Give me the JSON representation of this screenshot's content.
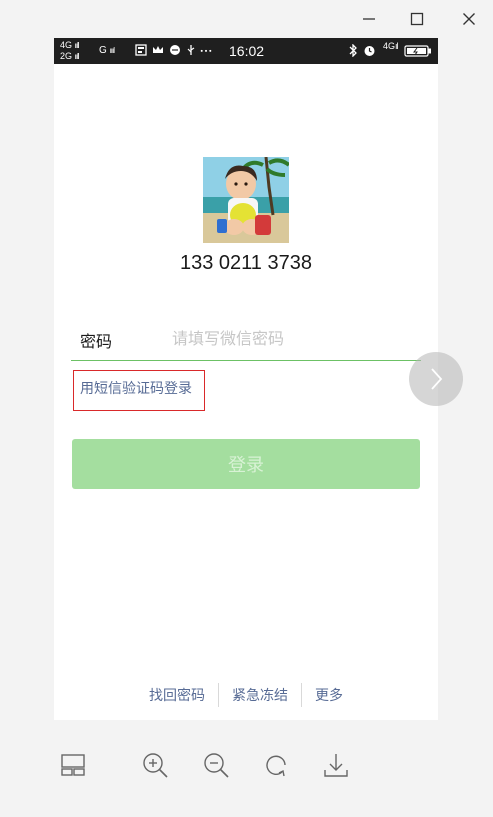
{
  "window": {
    "controls": [
      "minimize-icon",
      "maximize-icon",
      "close-icon"
    ]
  },
  "status_bar": {
    "net1": "4G",
    "net2": "2G",
    "gsm": "G",
    "time": "16:02",
    "net_right": "4G"
  },
  "login": {
    "phone_number": "133 0211 3738",
    "password_label": "密码",
    "password_placeholder": "请填写微信密码",
    "sms_login": "用短信验证码登录",
    "login_button": "登录"
  },
  "footer_links": {
    "recover": "找回密码",
    "freeze": "紧急冻结",
    "more": "更多"
  },
  "colors": {
    "accent_green": "#6cc165",
    "button_disabled": "#a4de9f",
    "link_blue": "#576b95",
    "highlight_red": "#d9292a"
  },
  "toolbar": {
    "items": [
      "layout-icon",
      "zoom-in-icon",
      "zoom-out-icon",
      "rotate-icon",
      "download-icon"
    ]
  }
}
